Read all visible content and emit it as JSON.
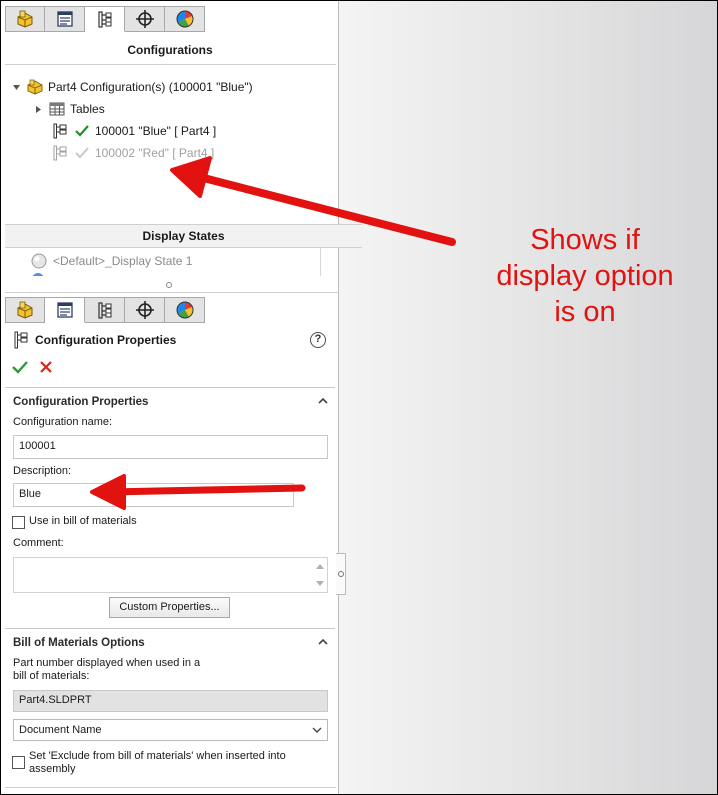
{
  "top_tabs": [
    {
      "icon": "feature-manager-icon"
    },
    {
      "icon": "property-manager-icon"
    },
    {
      "icon": "configuration-manager-icon",
      "active": true
    },
    {
      "icon": "dimxpert-manager-icon"
    },
    {
      "icon": "display-manager-icon"
    }
  ],
  "configurations": {
    "header": "Configurations",
    "root_label": "Part4 Configuration(s)  (100001 \"Blue\")",
    "tables_label": "Tables",
    "items": [
      {
        "label": "100001 \"Blue\" [ Part4 ]",
        "active": true
      },
      {
        "label": "100002 \"Red\" [ Part4 ]",
        "active": false
      }
    ]
  },
  "display_states": {
    "header": "Display States",
    "item": "<Default>_Display State 1"
  },
  "bottom_tabs": [
    {
      "icon": "feature-manager-icon"
    },
    {
      "icon": "property-manager-icon",
      "active": true
    },
    {
      "icon": "configuration-manager-icon"
    },
    {
      "icon": "dimxpert-manager-icon"
    },
    {
      "icon": "display-manager-icon"
    }
  ],
  "property_manager": {
    "title": "Configuration Properties",
    "help": "?",
    "group1": {
      "title": "Configuration Properties",
      "config_name_label": "Configuration name:",
      "config_name_value": "100001",
      "description_label": "Description:",
      "description_value": "Blue",
      "use_in_bom_label": "Use in bill of materials",
      "comment_label": "Comment:",
      "custom_props_button": "Custom Properties..."
    },
    "group2": {
      "title": "Bill of Materials Options",
      "part_number_label_1": "Part number displayed when used in a",
      "part_number_label_2": "bill of materials:",
      "part_number_value": "Part4.SLDPRT",
      "source_select": "Document Name",
      "exclude_label_1": "Set 'Exclude from bill of materials' when inserted into",
      "exclude_label_2": "assembly"
    }
  },
  "annotation": {
    "line1": "Shows if",
    "line2": "display option",
    "line3": "is on",
    "color": "#e1120f"
  }
}
